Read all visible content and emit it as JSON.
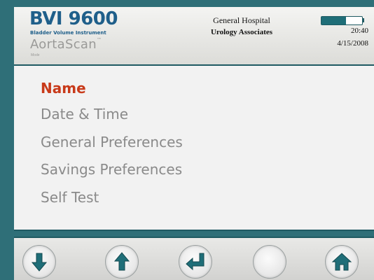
{
  "header": {
    "product_title": "BVI 9600",
    "product_subtitle": "Bladder Volume Instrument",
    "brand_name": "AortaScan",
    "brand_mark": "™",
    "mode_label": "Mode",
    "facility_name": "General Hospital",
    "department": "Urology Associates",
    "time": "20:40",
    "date": "4/15/2008",
    "battery_level": 0.6
  },
  "menu": {
    "items": [
      {
        "label": "Name",
        "selected": true
      },
      {
        "label": "Date & Time",
        "selected": false
      },
      {
        "label": "General Preferences",
        "selected": false
      },
      {
        "label": "Savings Preferences",
        "selected": false
      },
      {
        "label": "Self Test",
        "selected": false
      }
    ]
  },
  "toolbar": {
    "buttons": [
      {
        "icon": "arrow-down-icon"
      },
      {
        "icon": "arrow-up-icon"
      },
      {
        "icon": "enter-icon"
      },
      {
        "icon": "blank"
      },
      {
        "icon": "home-icon"
      }
    ]
  },
  "colors": {
    "frame": "#2f6f78",
    "accent_teal": "#1f6e78",
    "selected_text": "#c83a1a",
    "menu_text": "#8a8a8a",
    "logo_blue": "#1f5f8a"
  }
}
